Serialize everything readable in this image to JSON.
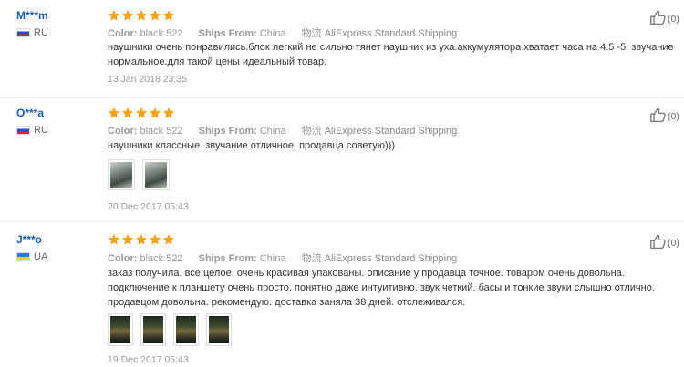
{
  "reviews": [
    {
      "user": "M***m",
      "country": "RU",
      "flag": "ru",
      "rating": 5,
      "color_label": "Color:",
      "color_value": "black 522",
      "ships_label": "Ships From:",
      "ships_value": "China",
      "logistics": "物流",
      "shipping": "AliExpress Standard Shipping",
      "text": "наушники очень понравились.блок легкий не сильно тянет наушник из уха.аккумулятора хватает часа на 4.5 -5. звучание нормальное.для такой цены идеальный товар.",
      "date": "13 Jan 2018 23:35",
      "likes": "(0)",
      "photos": []
    },
    {
      "user": "O***a",
      "country": "RU",
      "flag": "ru",
      "rating": 5,
      "color_label": "Color:",
      "color_value": "black 522",
      "ships_label": "Ships From:",
      "ships_value": "China",
      "logistics": "物流",
      "shipping": "AliExpress Standard Shipping",
      "text": "наушники классные. звучание отличное. продавца советую)))",
      "date": "20 Dec 2017 05:43",
      "likes": "(0)",
      "photos": [
        "hand",
        "hand"
      ]
    },
    {
      "user": "J***o",
      "country": "UA",
      "flag": "ua",
      "rating": 5,
      "color_label": "Color:",
      "color_value": "black 522",
      "ships_label": "Ships From:",
      "ships_value": "China",
      "logistics": "物流",
      "shipping": "AliExpress Standard Shipping",
      "text": "заказ получила. все целое. очень красивая упакованы. описание у продавца точное. товаром очень довольна. подключение к планшету очень просто. понятно даже интуитивно. звук четкий. басы и тонкие звуки слышно отлично. продавцом довольна. рекомендую. доставка заняла 38 дней. отслеживался.",
      "date": "19 Dec 2017 05:43",
      "likes": "(0)",
      "photos": [
        "dark",
        "dark",
        "dark",
        "dark"
      ]
    }
  ],
  "colors": {
    "star": "#f7a21b",
    "username": "#1a5ca8",
    "muted": "#999999",
    "divider": "#e6e6e6"
  },
  "icons": {
    "like": "thumbs-up-icon",
    "star": "star-icon"
  }
}
